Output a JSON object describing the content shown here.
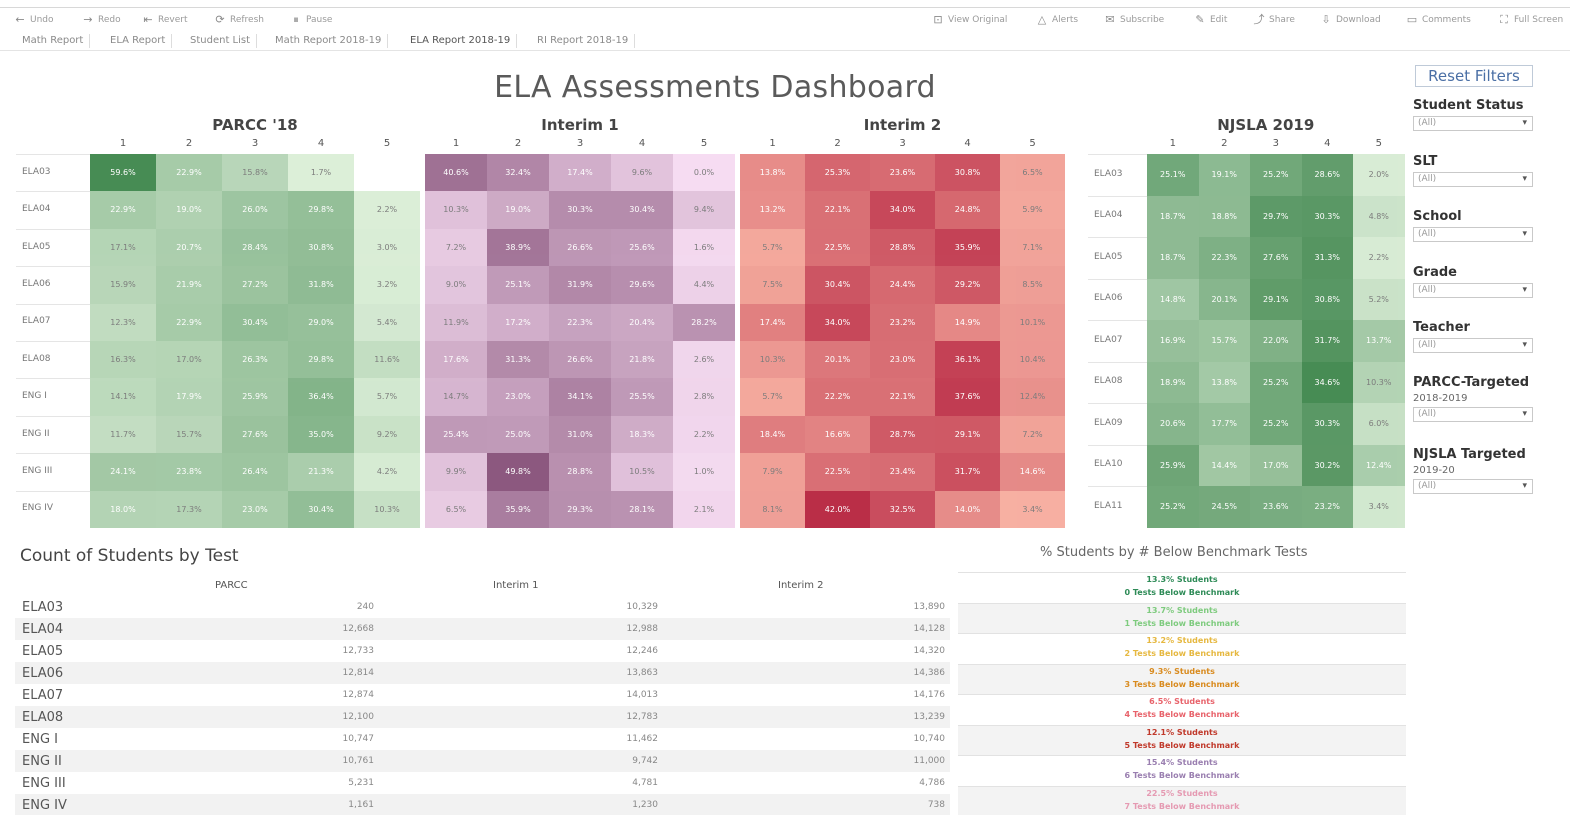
{
  "toolbar": {
    "left": [
      {
        "icon": "undo-icon",
        "glyph": "←",
        "label": "Undo"
      },
      {
        "icon": "redo-icon",
        "glyph": "→",
        "label": "Redo"
      },
      {
        "icon": "revert-icon",
        "glyph": "⇤",
        "label": "Revert"
      },
      {
        "icon": "refresh-icon",
        "glyph": "⟳",
        "label": "Refresh"
      },
      {
        "icon": "pause-icon",
        "glyph": "⏸",
        "label": "Pause"
      }
    ],
    "right": [
      {
        "icon": "view-original-icon",
        "glyph": "⊡",
        "label": "View Original"
      },
      {
        "icon": "alerts-icon",
        "glyph": "△",
        "label": "Alerts"
      },
      {
        "icon": "subscribe-icon",
        "glyph": "✉",
        "label": "Subscribe"
      },
      {
        "icon": "edit-icon",
        "glyph": "✎",
        "label": "Edit"
      },
      {
        "icon": "share-icon",
        "glyph": "⤴",
        "label": "Share"
      },
      {
        "icon": "download-icon",
        "glyph": "⇩",
        "label": "Download"
      },
      {
        "icon": "comments-icon",
        "glyph": "▭",
        "label": "Comments"
      },
      {
        "icon": "full-screen-icon",
        "glyph": "⛶",
        "label": "Full Screen"
      }
    ]
  },
  "tabs": [
    "Math Report",
    "ELA Report",
    "Student List",
    "Math Report 2018-19",
    "ELA Report 2018-19",
    "RI Report 2018-19"
  ],
  "active_tab": 4,
  "dashboard_title": "ELA Assessments Dashboard",
  "heatmaps": [
    {
      "title": "PARCC '18",
      "palette": "green",
      "columns": [
        "1",
        "2",
        "3",
        "4",
        "5"
      ],
      "rows": [
        "ELA03",
        "ELA04",
        "ELA05",
        "ELA06",
        "ELA07",
        "ELA08",
        "ENG I",
        "ENG II",
        "ENG III",
        "ENG IV"
      ],
      "values": [
        [
          "59.6%",
          "22.9%",
          "15.8%",
          "1.7%",
          ""
        ],
        [
          "22.9%",
          "19.0%",
          "26.0%",
          "29.8%",
          "2.2%"
        ],
        [
          "17.1%",
          "20.7%",
          "28.4%",
          "30.8%",
          "3.0%"
        ],
        [
          "15.9%",
          "21.9%",
          "27.2%",
          "31.8%",
          "3.2%"
        ],
        [
          "12.3%",
          "22.9%",
          "30.4%",
          "29.0%",
          "5.4%"
        ],
        [
          "16.3%",
          "17.0%",
          "26.3%",
          "29.8%",
          "11.6%"
        ],
        [
          "14.1%",
          "17.9%",
          "25.9%",
          "36.4%",
          "5.7%"
        ],
        [
          "11.7%",
          "15.7%",
          "27.6%",
          "35.0%",
          "9.2%"
        ],
        [
          "24.1%",
          "23.8%",
          "26.4%",
          "21.3%",
          "4.2%"
        ],
        [
          "18.0%",
          "17.3%",
          "23.0%",
          "30.4%",
          "10.3%"
        ]
      ]
    },
    {
      "title": "Interim 1",
      "palette": "purple",
      "columns": [
        "1",
        "2",
        "3",
        "4",
        "5"
      ],
      "rows": [
        "ELA03",
        "ELA04",
        "ELA05",
        "ELA06",
        "ELA07",
        "ELA08",
        "ENG I",
        "ENG II",
        "ENG III",
        "ENG IV"
      ],
      "values": [
        [
          "40.6%",
          "32.4%",
          "17.4%",
          "9.6%",
          "0.0%"
        ],
        [
          "10.3%",
          "19.0%",
          "30.3%",
          "30.4%",
          "9.4%"
        ],
        [
          "7.2%",
          "38.9%",
          "26.6%",
          "25.6%",
          "1.6%"
        ],
        [
          "9.0%",
          "25.1%",
          "31.9%",
          "29.6%",
          "4.4%"
        ],
        [
          "11.9%",
          "17.2%",
          "22.3%",
          "20.4%",
          "28.2%"
        ],
        [
          "17.6%",
          "31.3%",
          "26.6%",
          "21.8%",
          "2.6%"
        ],
        [
          "14.7%",
          "23.0%",
          "34.1%",
          "25.5%",
          "2.8%"
        ],
        [
          "25.4%",
          "25.0%",
          "31.0%",
          "18.3%",
          "2.2%"
        ],
        [
          "9.9%",
          "49.8%",
          "28.8%",
          "10.5%",
          "1.0%"
        ],
        [
          "6.5%",
          "35.9%",
          "29.3%",
          "28.1%",
          "2.1%"
        ]
      ]
    },
    {
      "title": "Interim 2",
      "palette": "red",
      "columns": [
        "1",
        "2",
        "3",
        "4",
        "5"
      ],
      "rows": [
        "ELA03",
        "ELA04",
        "ELA05",
        "ELA06",
        "ELA07",
        "ELA08",
        "ENG I",
        "ENG II",
        "ENG III",
        "ENG IV"
      ],
      "values": [
        [
          "13.8%",
          "25.3%",
          "23.6%",
          "30.8%",
          "6.5%"
        ],
        [
          "13.2%",
          "22.1%",
          "34.0%",
          "24.8%",
          "5.9%"
        ],
        [
          "5.7%",
          "22.5%",
          "28.8%",
          "35.9%",
          "7.1%"
        ],
        [
          "7.5%",
          "30.4%",
          "24.4%",
          "29.2%",
          "8.5%"
        ],
        [
          "17.4%",
          "34.0%",
          "23.2%",
          "14.9%",
          "10.1%"
        ],
        [
          "10.3%",
          "20.1%",
          "23.0%",
          "36.1%",
          "10.4%"
        ],
        [
          "5.7%",
          "22.2%",
          "22.1%",
          "37.6%",
          "12.4%"
        ],
        [
          "18.4%",
          "16.6%",
          "28.7%",
          "29.1%",
          "7.2%"
        ],
        [
          "7.9%",
          "22.5%",
          "23.4%",
          "31.7%",
          "14.6%"
        ],
        [
          "8.1%",
          "42.0%",
          "32.5%",
          "14.0%",
          "3.4%"
        ]
      ]
    },
    {
      "title": "NJSLA 2019",
      "palette": "green",
      "columns": [
        "1",
        "2",
        "3",
        "4",
        "5"
      ],
      "rows": [
        "ELA03",
        "ELA04",
        "ELA05",
        "ELA06",
        "ELA07",
        "ELA08",
        "ELA09",
        "ELA10",
        "ELA11"
      ],
      "values": [
        [
          "25.1%",
          "19.1%",
          "25.2%",
          "28.6%",
          "2.0%"
        ],
        [
          "18.7%",
          "18.8%",
          "29.7%",
          "30.3%",
          "4.8%"
        ],
        [
          "18.7%",
          "22.3%",
          "27.6%",
          "31.3%",
          "2.2%"
        ],
        [
          "14.8%",
          "20.1%",
          "29.1%",
          "30.8%",
          "5.2%"
        ],
        [
          "16.9%",
          "15.7%",
          "22.0%",
          "31.7%",
          "13.7%"
        ],
        [
          "18.9%",
          "13.8%",
          "25.2%",
          "34.6%",
          "10.3%"
        ],
        [
          "20.6%",
          "17.7%",
          "25.2%",
          "30.3%",
          "6.0%"
        ],
        [
          "25.9%",
          "14.4%",
          "17.0%",
          "30.2%",
          "12.4%"
        ],
        [
          "25.2%",
          "24.5%",
          "23.6%",
          "23.2%",
          "3.4%"
        ]
      ]
    }
  ],
  "filters": {
    "reset_label": "Reset Filters",
    "items": [
      {
        "label": "Student Status",
        "sub": "",
        "value": "(All)"
      },
      {
        "label": "SLT",
        "sub": "",
        "value": "(All)"
      },
      {
        "label": "School",
        "sub": "",
        "value": "(All)"
      },
      {
        "label": "Grade",
        "sub": "",
        "value": "(All)"
      },
      {
        "label": "Teacher",
        "sub": "",
        "value": "(All)"
      },
      {
        "label": "PARCC-Targeted",
        "sub": "2018-2019",
        "value": "(All)"
      },
      {
        "label": "NJSLA Targeted",
        "sub": "2019-20",
        "value": "(All)"
      }
    ]
  },
  "count_table": {
    "title": "Count of Students by Test",
    "headers": [
      "PARCC",
      "Interim 1",
      "Interim 2"
    ],
    "rows": [
      {
        "label": "ELA03",
        "values": [
          "240",
          "10,329",
          "13,890"
        ]
      },
      {
        "label": "ELA04",
        "values": [
          "12,668",
          "12,988",
          "14,128"
        ]
      },
      {
        "label": "ELA05",
        "values": [
          "12,733",
          "12,246",
          "14,320"
        ]
      },
      {
        "label": "ELA06",
        "values": [
          "12,814",
          "13,863",
          "14,386"
        ]
      },
      {
        "label": "ELA07",
        "values": [
          "12,874",
          "14,013",
          "14,176"
        ]
      },
      {
        "label": "ELA08",
        "values": [
          "12,100",
          "12,783",
          "13,239"
        ]
      },
      {
        "label": "ENG I",
        "values": [
          "10,747",
          "11,462",
          "10,740"
        ]
      },
      {
        "label": "ENG II",
        "values": [
          "10,761",
          "9,742",
          "11,000"
        ]
      },
      {
        "label": "ENG III",
        "values": [
          "5,231",
          "4,781",
          "4,786"
        ]
      },
      {
        "label": "ENG IV",
        "values": [
          "1,161",
          "1,230",
          "738"
        ]
      }
    ]
  },
  "pct_panel": {
    "title": "% Students by # Below Benchmark Tests",
    "rows": [
      {
        "line1": "13.3% Students",
        "line2": "0 Tests Below Benchmark",
        "color": "#2e8b57"
      },
      {
        "line1": "13.7% Students",
        "line2": "1 Tests Below Benchmark",
        "color": "#7ecb7e"
      },
      {
        "line1": "13.2% Students",
        "line2": "2 Tests Below Benchmark",
        "color": "#e6b840"
      },
      {
        "line1": "9.3% Students",
        "line2": "3 Tests Below Benchmark",
        "color": "#d98b1f"
      },
      {
        "line1": "6.5% Students",
        "line2": "4 Tests Below Benchmark",
        "color": "#e8636b"
      },
      {
        "line1": "12.1% Students",
        "line2": "5 Tests Below Benchmark",
        "color": "#c0392b"
      },
      {
        "line1": "15.4% Students",
        "line2": "6 Tests Below Benchmark",
        "color": "#9a7fb0"
      },
      {
        "line1": "22.5% Students",
        "line2": "7 Tests Below Benchmark",
        "color": "#e59ab2"
      }
    ]
  }
}
